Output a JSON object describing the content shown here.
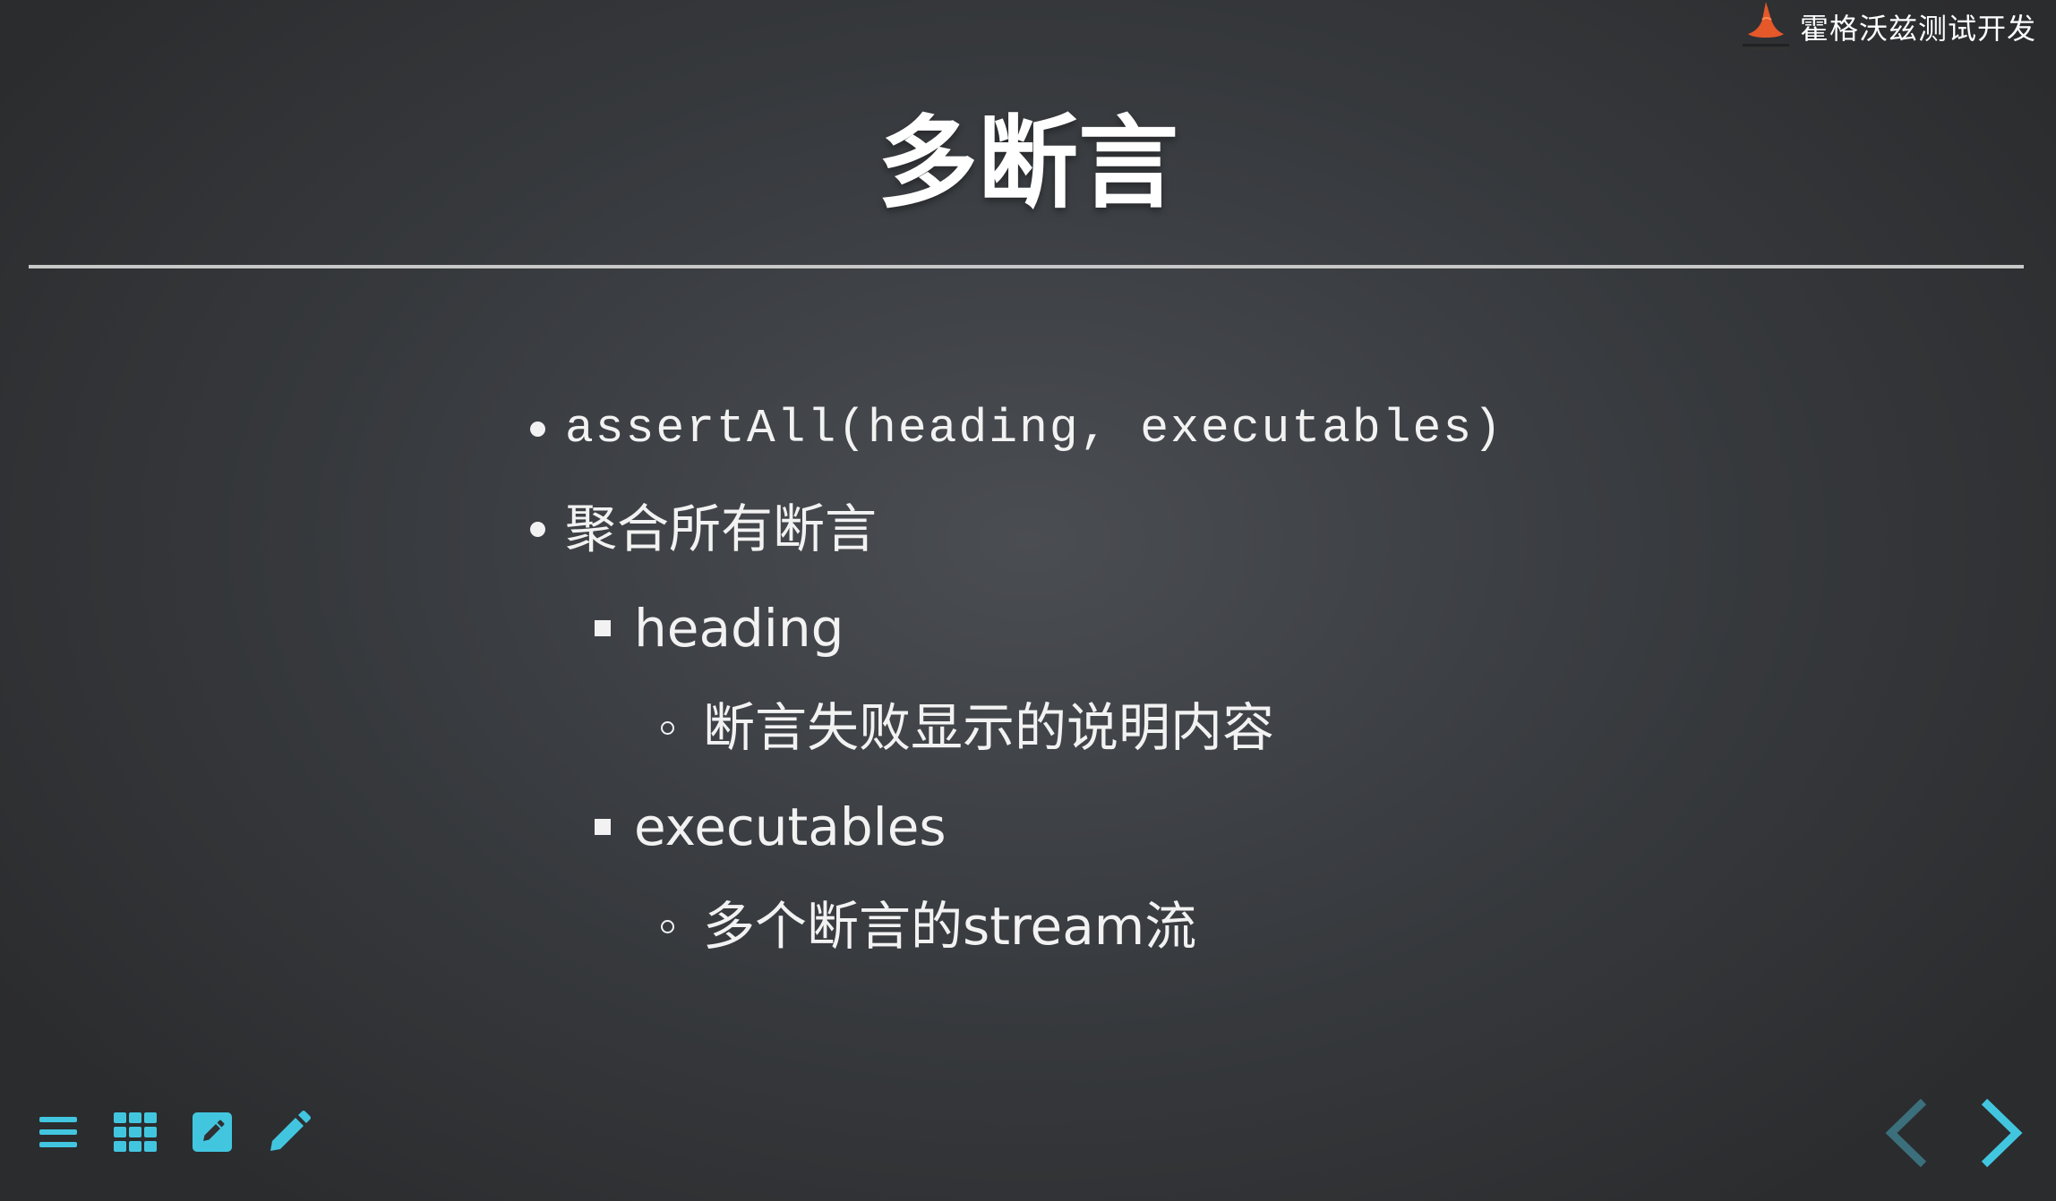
{
  "brand": {
    "name": "霍格沃兹测试开发",
    "logo_icon": "witch-hat-logo-icon"
  },
  "slide": {
    "title": "多断言",
    "bullets": [
      {
        "level": 1,
        "marker": "disc",
        "text": "assertAll(heading, executables)",
        "monospace": true
      },
      {
        "level": 1,
        "marker": "disc",
        "text": "聚合所有断言"
      },
      {
        "level": 2,
        "marker": "square",
        "text": "heading"
      },
      {
        "level": 3,
        "marker": "circle",
        "text": "断言失败显示的说明内容"
      },
      {
        "level": 2,
        "marker": "square",
        "text": "executables"
      },
      {
        "level": 3,
        "marker": "circle",
        "text": "多个断言的stream流"
      }
    ]
  },
  "toolbar": {
    "icons": [
      "menu-icon",
      "grid-icon",
      "edit-note-icon",
      "pencil-icon"
    ]
  },
  "navigation": {
    "prev_icon": "chevron-left-icon",
    "next_icon": "chevron-right-icon",
    "prev_enabled": false,
    "next_enabled": true
  },
  "colors": {
    "accent": "#42c6e0",
    "accent_dim": "#3b6f7c",
    "text": "#f2f2f2",
    "rule": "#c8c8c8",
    "logo_orange": "#e5582a"
  }
}
